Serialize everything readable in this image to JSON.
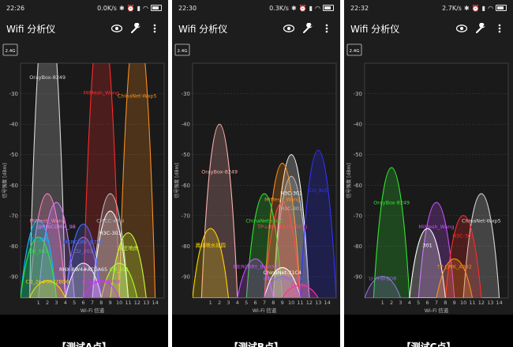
{
  "panels": [
    {
      "time": "22:26",
      "net_speed": "0.0K/s",
      "app_title": "Wifi 分析仪",
      "band": "2.4G",
      "caption": "【测试A点】",
      "chart_data": {
        "type": "area",
        "ylabel": "信号强度 [dBm]",
        "xlabel": "Wi-Fi 信道",
        "ylim": [
          -97,
          -20
        ],
        "yticks": [
          -30,
          -40,
          -50,
          -60,
          -70,
          -80,
          -90
        ],
        "xlim": [
          -1,
          15
        ],
        "xticks": [
          1,
          2,
          3,
          4,
          5,
          6,
          7,
          8,
          9,
          10,
          11,
          12,
          13,
          14
        ],
        "networks": [
          {
            "name": "OrayBox-8249",
            "channel": 2,
            "dbm": -26,
            "color": "#d9d9d9"
          },
          {
            "name": "MiMesh_Wang",
            "channel": 8,
            "dbm": -31,
            "color": "#ff2a2a"
          },
          {
            "name": "ChinaNet-Wxp5",
            "channel": 12,
            "dbm": -32,
            "color": "#ff8c1a"
          },
          {
            "name": "MiMesh_Wang",
            "channel": 2,
            "dbm": -73,
            "color": "#ff80c0"
          },
          {
            "name": "CMCC-x3ui",
            "channel": 9,
            "dbm": -73,
            "color": "#bdbdbd"
          },
          {
            "name": "@PHICOMM_98",
            "channel": 3,
            "dbm": -75,
            "color": "#d580ff"
          },
          {
            "name": "H3C-301",
            "channel": 9,
            "dbm": -77,
            "color": "#ffffff"
          },
          {
            "name": "CU_3Jfb",
            "channel": 1,
            "dbm": -79,
            "color": "#00bfff"
          },
          {
            "name": "MERCURY_B7A0",
            "channel": 6,
            "dbm": -80,
            "color": "#4d6dff"
          },
          {
            "name": "CU_Sir2",
            "channel": 1,
            "dbm": -83,
            "color": "#32e632"
          },
          {
            "name": "天王地虎",
            "channel": 11,
            "dbm": -82,
            "color": "#c8ff32"
          },
          {
            "name": "CU_201",
            "channel": 6,
            "dbm": -83,
            "color": "#9370db"
          },
          {
            "name": "RHX-8W4#AEDA65",
            "channel": 6,
            "dbm": -89,
            "color": "#f0f0f0"
          },
          {
            "name": "CU_501",
            "channel": 10,
            "dbm": -89,
            "color": "#adff2f"
          },
          {
            "name": "CU_2n#0022BD0",
            "channel": 2,
            "dbm": -93,
            "color": "#ffd700"
          },
          {
            "name": "HUAWEI-7EP6X",
            "channel": 8,
            "dbm": -93,
            "color": "#c832ff"
          }
        ]
      }
    },
    {
      "time": "22:30",
      "net_speed": "0.3K/s",
      "app_title": "Wifi 分析仪",
      "band": "2.4G",
      "caption": "【测试B点】",
      "chart_data": {
        "type": "area",
        "ylabel": "信号强度 [dBm]",
        "xlabel": "Wi-Fi 信道",
        "ylim": [
          -97,
          -20
        ],
        "yticks": [
          -30,
          -40,
          -50,
          -60,
          -70,
          -80,
          -90
        ],
        "xlim": [
          -1,
          15
        ],
        "xticks": [
          1,
          2,
          3,
          4,
          5,
          6,
          7,
          8,
          9,
          10,
          11,
          12,
          13,
          14
        ],
        "networks": [
          {
            "name": "OrayBox-8249",
            "channel": 2,
            "dbm": -57,
            "color": "#ffb0b0"
          },
          {
            "name": "H3C-301",
            "channel": 10,
            "dbm": -64,
            "color": "#ffffff"
          },
          {
            "name": "MiMesh_Wang",
            "channel": 9,
            "dbm": -66,
            "color": "#ff8c1a"
          },
          {
            "name": "H3C-301",
            "channel": 10,
            "dbm": -69,
            "color": "#bdbdbd"
          },
          {
            "name": "ChinaNet-rXqC",
            "channel": 7,
            "dbm": -73,
            "color": "#32e632"
          },
          {
            "name": "TP-LINK_1A16 (501)",
            "channel": 9,
            "dbm": -75,
            "color": "#ff4d4d"
          },
          {
            "name": "晨相晓水效园",
            "channel": 1,
            "dbm": -81,
            "color": "#ffd700"
          },
          {
            "name": "CU_9x5",
            "channel": 13,
            "dbm": -63,
            "color": "#3232ff"
          },
          {
            "name": "MERCURY_B#A92",
            "channel": 6,
            "dbm": -88,
            "color": "#c850ff"
          },
          {
            "name": "ChinaNet-31C4",
            "channel": 9,
            "dbm": -90,
            "color": "#ffffff"
          },
          {
            "name": "@PHICOMM_98",
            "channel": 9,
            "dbm": -92,
            "color": "#9370db"
          },
          {
            "name": "CU_9x5",
            "channel": 11,
            "dbm": -94,
            "color": "#ff3296"
          }
        ]
      }
    },
    {
      "time": "22:32",
      "net_speed": "2.7K/s",
      "app_title": "Wifi 分析仪",
      "band": "2.4G",
      "caption": "【测试C点】",
      "chart_data": {
        "type": "area",
        "ylabel": "信号强度 [dBm]",
        "xlabel": "Wi-Fi 信道",
        "ylim": [
          -97,
          -20
        ],
        "yticks": [
          -30,
          -40,
          -50,
          -60,
          -70,
          -80,
          -90
        ],
        "xlim": [
          -1,
          15
        ],
        "xticks": [
          1,
          2,
          3,
          4,
          5,
          6,
          7,
          8,
          9,
          10,
          11,
          12,
          13,
          14
        ],
        "networks": [
          {
            "name": "OrayBox-8249",
            "channel": 2,
            "dbm": -67,
            "color": "#32e632"
          },
          {
            "name": "MiMesh_Wang",
            "channel": 7,
            "dbm": -75,
            "color": "#c850ff"
          },
          {
            "name": "ChinaNet-Wxp5",
            "channel": 12,
            "dbm": -73,
            "color": "#d9d9d9"
          },
          {
            "name": "H3C-301",
            "channel": 10,
            "dbm": -78,
            "color": "#ff2a2a"
          },
          {
            "name": "301",
            "channel": 6,
            "dbm": -81,
            "color": "#ffffff"
          },
          {
            "name": "TP-LINK_A392",
            "channel": 9,
            "dbm": -88,
            "color": "#ff8c1a"
          },
          {
            "name": "U-PF8FB08",
            "channel": 1,
            "dbm": -92,
            "color": "#9370db"
          }
        ]
      }
    }
  ]
}
